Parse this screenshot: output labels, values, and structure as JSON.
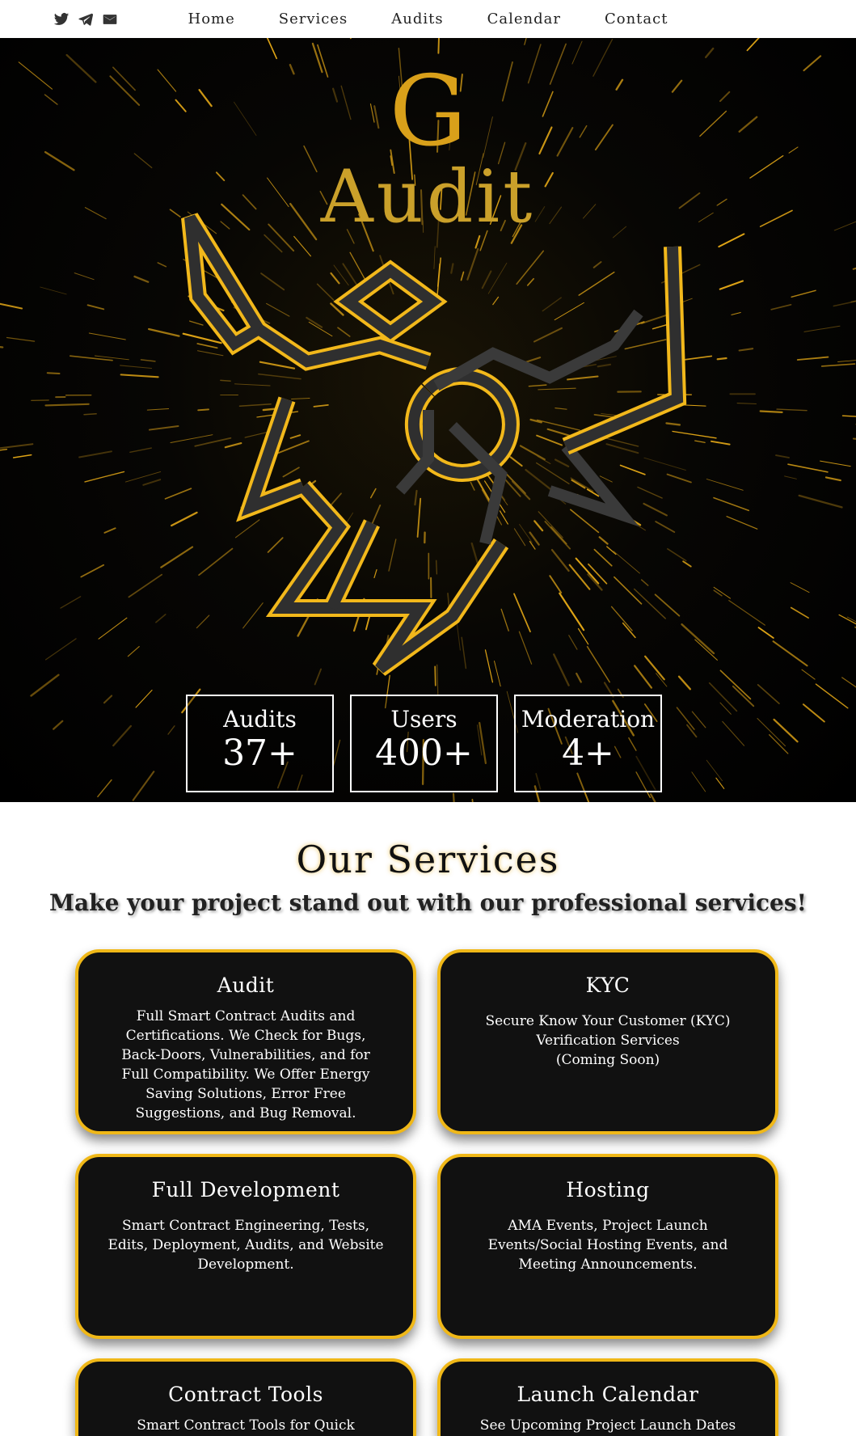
{
  "nav": {
    "social": [
      {
        "icon": "twitter-icon"
      },
      {
        "icon": "telegram-icon"
      },
      {
        "icon": "mail-icon"
      }
    ],
    "links": [
      "Home",
      "Services",
      "Audits",
      "Calendar",
      "Contact"
    ]
  },
  "hero": {
    "brand_letter": "G",
    "brand_word": "Audit",
    "stats": [
      {
        "label": "Audits",
        "value": "37+"
      },
      {
        "label": "Users",
        "value": "400+"
      },
      {
        "label": "Moderation",
        "value": "4+"
      }
    ]
  },
  "services": {
    "title": "Our Services",
    "subtitle": "Make your project stand out with our professional services!",
    "cards": [
      {
        "title": "Audit",
        "text": "Full Smart Contract Audits and Certifications. We Check for Bugs, Back-Doors, Vulnerabilities, and for Full Compatibility. We Offer Energy Saving Solutions, Error Free Suggestions, and Bug Removal."
      },
      {
        "title": "KYC",
        "text": "Secure Know Your Customer (KYC)\nVerification Services\n(Coming Soon)"
      },
      {
        "title": "Full Development",
        "text": "Smart Contract Engineering, Tests, Edits, Deployment, Audits, and Website Development."
      },
      {
        "title": "Hosting",
        "text": "AMA Events, Project Launch Events/Social Hosting Events, and Meeting Announcements."
      },
      {
        "title": "Contract Tools",
        "text": "Smart Contract Tools for Quick Analysis"
      },
      {
        "title": "Launch Calendar",
        "text": "See Upcoming Project Launch Dates and"
      }
    ]
  },
  "colors": {
    "gold": "#f0b818",
    "brand_gold": "#d9a01a",
    "card_bg": "#111111"
  }
}
